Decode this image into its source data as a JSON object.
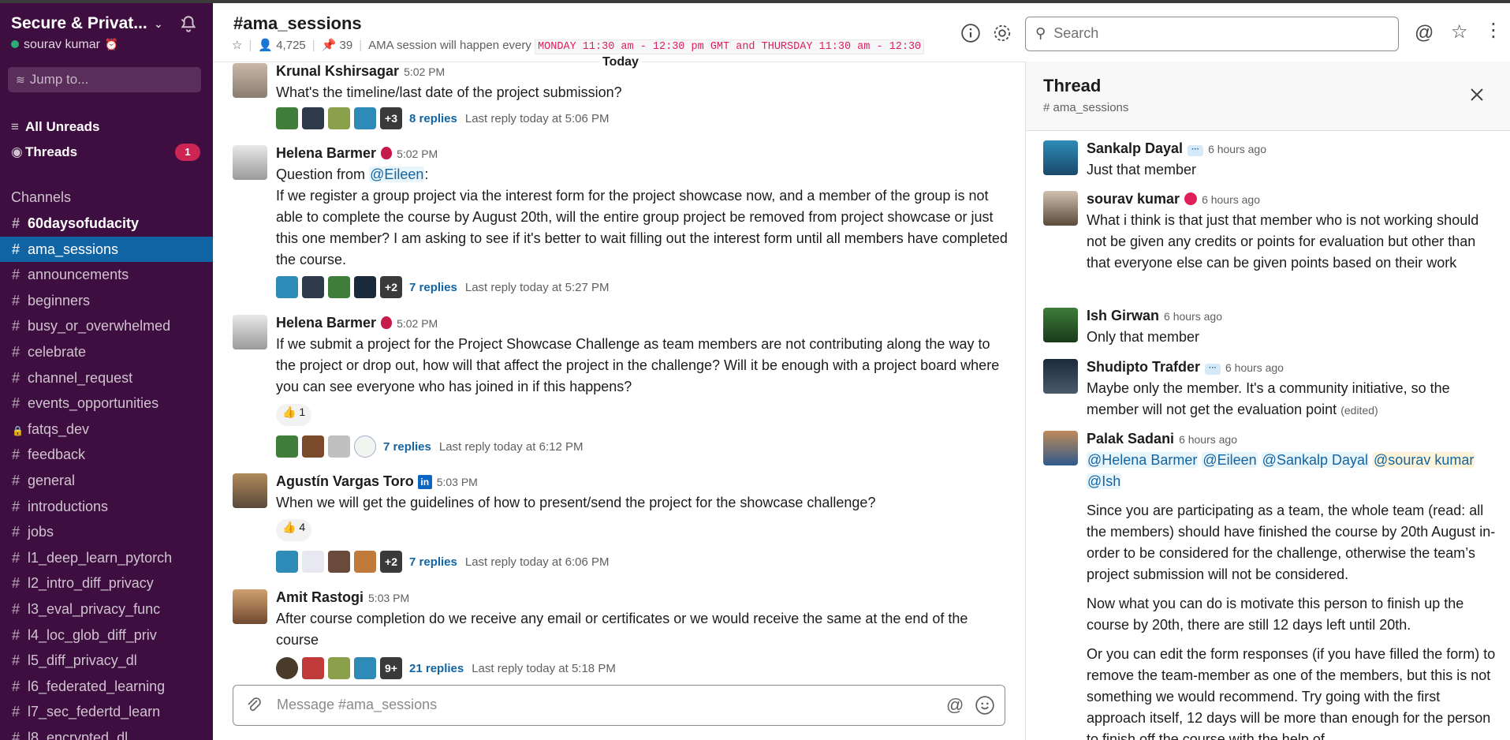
{
  "workspace": {
    "name": "Secure & Privat...",
    "user": "sourav kumar"
  },
  "sidebar": {
    "jump_placeholder": "Jump to...",
    "all_unreads": "All Unreads",
    "threads": "Threads",
    "threads_count": "1",
    "channels_header": "Channels",
    "channels": [
      {
        "name": "60daysofudacity",
        "bold": true,
        "active": false,
        "private": false
      },
      {
        "name": "ama_sessions",
        "bold": false,
        "active": true,
        "private": false
      },
      {
        "name": "announcements",
        "bold": false,
        "active": false,
        "private": false
      },
      {
        "name": "beginners",
        "bold": false,
        "active": false,
        "private": false
      },
      {
        "name": "busy_or_overwhelmed",
        "bold": false,
        "active": false,
        "private": false
      },
      {
        "name": "celebrate",
        "bold": false,
        "active": false,
        "private": false
      },
      {
        "name": "channel_request",
        "bold": false,
        "active": false,
        "private": false
      },
      {
        "name": "events_opportunities",
        "bold": false,
        "active": false,
        "private": false
      },
      {
        "name": "fatqs_dev",
        "bold": false,
        "active": false,
        "private": true
      },
      {
        "name": "feedback",
        "bold": false,
        "active": false,
        "private": false
      },
      {
        "name": "general",
        "bold": false,
        "active": false,
        "private": false
      },
      {
        "name": "introductions",
        "bold": false,
        "active": false,
        "private": false
      },
      {
        "name": "jobs",
        "bold": false,
        "active": false,
        "private": false
      },
      {
        "name": "l1_deep_learn_pytorch",
        "bold": false,
        "active": false,
        "private": false
      },
      {
        "name": "l2_intro_diff_privacy",
        "bold": false,
        "active": false,
        "private": false
      },
      {
        "name": "l3_eval_privacy_func",
        "bold": false,
        "active": false,
        "private": false
      },
      {
        "name": "l4_loc_glob_diff_priv",
        "bold": false,
        "active": false,
        "private": false
      },
      {
        "name": "l5_diff_privacy_dl",
        "bold": false,
        "active": false,
        "private": false
      },
      {
        "name": "l6_federated_learning",
        "bold": false,
        "active": false,
        "private": false
      },
      {
        "name": "l7_sec_federtd_learn",
        "bold": false,
        "active": false,
        "private": false
      },
      {
        "name": "l8_encrypted_dl",
        "bold": false,
        "active": false,
        "private": false
      }
    ]
  },
  "channel": {
    "title": "#ama_sessions",
    "members": "4,725",
    "pinned": "39",
    "topic_prefix": "AMA session will happen every",
    "topic_code": "MONDAY 11:30 am - 12:30 pm GMT and THURSDAY 11:30 am - 12:30"
  },
  "search": {
    "placeholder": "Search"
  },
  "divider": "Today",
  "messages": [
    {
      "name": "Krunal Kshirsagar",
      "time": "5:02 PM",
      "text": "What's the timeline/last date of the project submission?",
      "replies": "8 replies",
      "last": "Last reply today at 5:06 PM",
      "more": "+3"
    },
    {
      "name": "Helena Barmer",
      "time": "5:02 PM",
      "q_prefix": "Question from",
      "q_mention": "@Eileen",
      "q_suffix": ":",
      "text": "If we register a group project via the interest form for the project showcase now, and a member of the group is not able to complete the course by August 20th, will the entire group project be removed from project showcase or just this one member? I am asking to see if it's better to wait filling out the interest form until all members have completed the course.",
      "replies": "7 replies",
      "last": "Last reply today at 5:27 PM",
      "more": "+2"
    },
    {
      "name": "Helena Barmer",
      "time": "5:02 PM",
      "text": "If we submit a project for the Project Showcase Challenge as team members are not contributing along the way to the project or drop out, how will that affect the project in the challenge? Will it be enough with a project board where you can see everyone who has joined in if this happens?",
      "reaction": "1",
      "replies": "7 replies",
      "last": "Last reply today at 6:12 PM"
    },
    {
      "name": "Agustín Vargas Toro",
      "badge": "in",
      "time": "5:03 PM",
      "text": "When we will get the guidelines of how to present/send the project for the showcase challenge?",
      "reaction": "4",
      "replies": "7 replies",
      "last": "Last reply today at 6:06 PM",
      "more": "+2"
    },
    {
      "name": "Amit Rastogi",
      "time": "5:03 PM",
      "text": "After course completion do we receive any email or certificates or we would receive the same at the end of the course",
      "replies": "21 replies",
      "last": "Last reply today at 5:18 PM",
      "more": "9+"
    }
  ],
  "composer": {
    "placeholder": "Message #ama_sessions"
  },
  "thread": {
    "title": "Thread",
    "channel": "# ama_sessions",
    "messages": [
      {
        "name": "Sankalp Dayal",
        "time": "6 hours ago",
        "text": "Just that member"
      },
      {
        "name": "sourav kumar",
        "time": "6 hours ago",
        "text": "What i think is that just that member who is not working should not be given any credits or points for evaluation but other than that everyone else can be given points based on their work"
      },
      {
        "name": "Ish Girwan",
        "time": "6 hours ago",
        "text": "Only that member"
      },
      {
        "name": "Shudipto Trafder",
        "time": "6 hours ago",
        "text": "Maybe only the member. It's a community initiative, so the member will not get the evaluation point",
        "edited": "(edited)"
      },
      {
        "name": "Palak Sadani",
        "time": "6 hours ago",
        "mentions": [
          "@Helena Barmer",
          "@Eileen",
          "@Sankalp Dayal",
          "@sourav kumar",
          "@Ish"
        ],
        "p1": "Since you are participating as a team, the whole team (read: all the members) should have finished the course by 20th August in-order to be considered for the challenge, otherwise the team’s project submission will not be considered.",
        "p2": "Now what you can do is motivate this person to finish up the course by 20th, there are still 12 days left until 20th.",
        "p3": "Or you can edit the form responses (if you have filled the form) to remove the team-member as one of the members, but this is not something we would recommend. Try going with the first approach itself, 12 days will be more than enough for the person to finish off the course with the help of"
      }
    ]
  },
  "colors": {
    "sidebar": "#3f0e40",
    "active": "#1164a3",
    "link": "#1264a3",
    "badge": "#cd2553"
  }
}
